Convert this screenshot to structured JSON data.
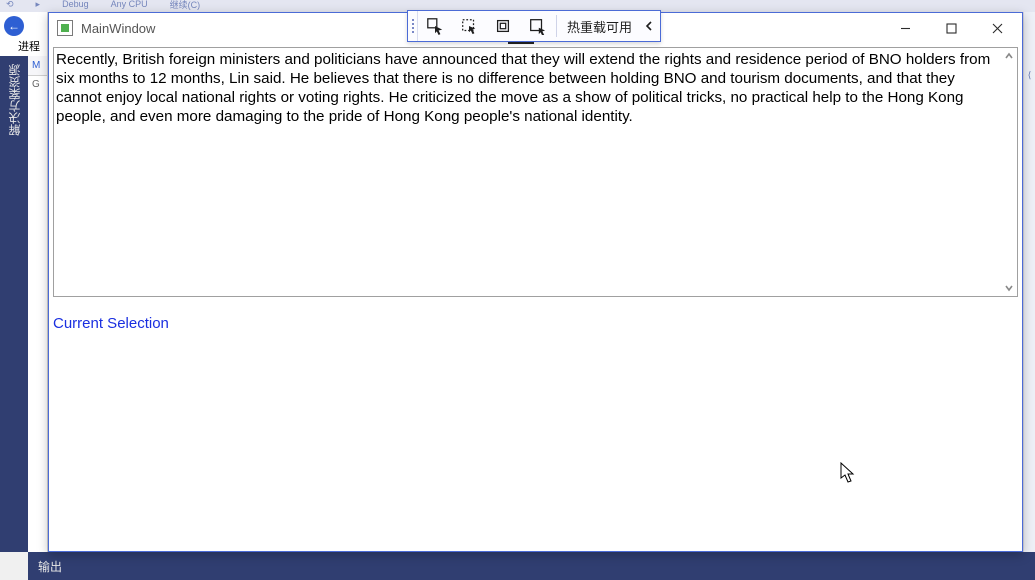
{
  "background": {
    "top_menu_items": [
      "⟲",
      "▸",
      "Debug",
      "Any CPU",
      "继续(C)"
    ],
    "back_button_glyph": "←",
    "process_label": "进程",
    "sidebar_vertical_text": "解决方案资源",
    "left_tab_m": "M",
    "left_tab_g": "G",
    "right_mark": "⟨",
    "bottom_label": "输出"
  },
  "hotbar": {
    "label": "热重载可用",
    "collapse_glyph": "‹"
  },
  "window": {
    "title": "MainWindow",
    "textbox_value": "Recently, British foreign ministers and politicians have announced that they will extend the rights and residence period of BNO holders from six months to 12 months, Lin said. He believes that there is no difference between holding BNO and tourism documents, and that they cannot enjoy local national rights or voting rights. He criticized the move as a show of political tricks, no practical help to the Hong Kong people, and even more damaging to the pride of Hong Kong people's national identity.",
    "link_label": "Current Selection"
  }
}
